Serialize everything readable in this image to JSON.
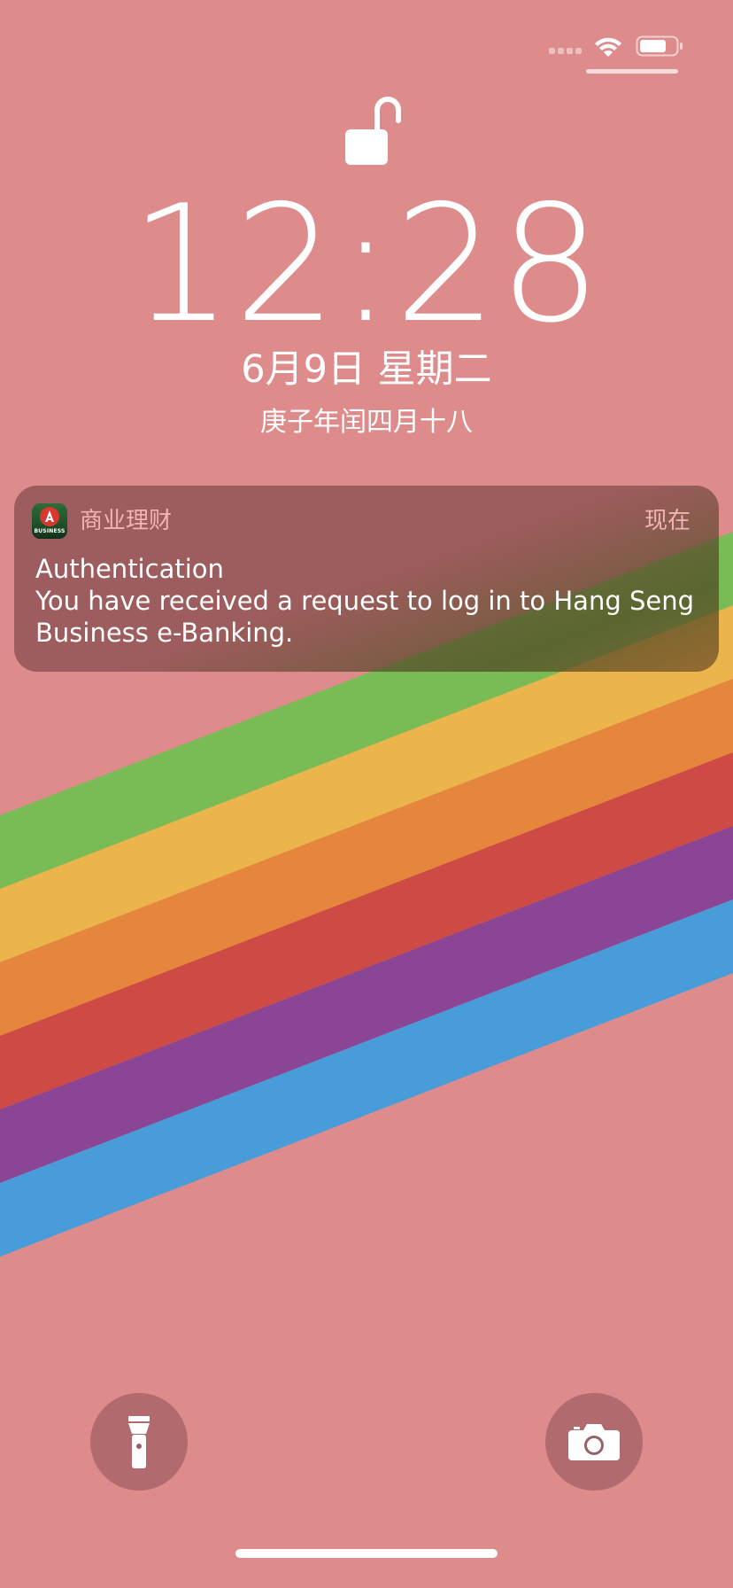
{
  "lock_screen": {
    "time": "12:28",
    "date": "6月9日 星期二",
    "lunar_date": "庚子年闰四月十八"
  },
  "notification": {
    "app_name": "商业理财",
    "timestamp": "现在",
    "title": "Authentication",
    "body": "You have received a request to log in to Hang Seng Business e-Banking.",
    "app_icon_text": "BUSINESS"
  },
  "status_bar": {
    "icons": [
      "signal-icon",
      "wifi-icon",
      "battery-icon"
    ],
    "battery_level": 0.75
  },
  "quick_actions": [
    "flashlight-icon",
    "camera-icon"
  ],
  "colors": {
    "background": "#de8b8b",
    "stripe_green": "#79bb55",
    "stripe_yellow": "#ebb54b",
    "stripe_orange": "#e6853c",
    "stripe_red": "#cd4a45",
    "stripe_purple": "#8a4694",
    "stripe_blue": "#479cd9"
  }
}
